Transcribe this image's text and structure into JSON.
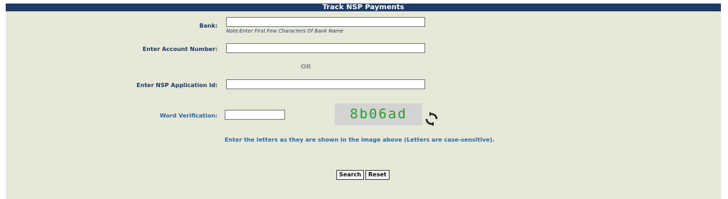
{
  "form": {
    "title": "Track NSP Payments",
    "bank_label": "Bank:",
    "bank_value": "",
    "bank_note": "Note:Enter First Few Characters Of Bank Name",
    "account_label": "Enter Account Number:",
    "account_value": "",
    "or_text": "OR",
    "app_id_label": "Enter NSP Application Id:",
    "app_id_value": "",
    "word_label": "Word Verification:",
    "word_value": "",
    "captcha_text": "8b06ad",
    "instructions": "Enter the letters as they are shown in the image above (Letters are case-sensitive).",
    "search_label": "Search",
    "reset_label": "Reset"
  },
  "icons": {
    "refresh": "refresh-icon"
  },
  "colors": {
    "titlebar": "#1f3a66",
    "panel": "#e8e8d8",
    "captcha_text": "#2e9a2e",
    "label": "#1f3a66"
  }
}
